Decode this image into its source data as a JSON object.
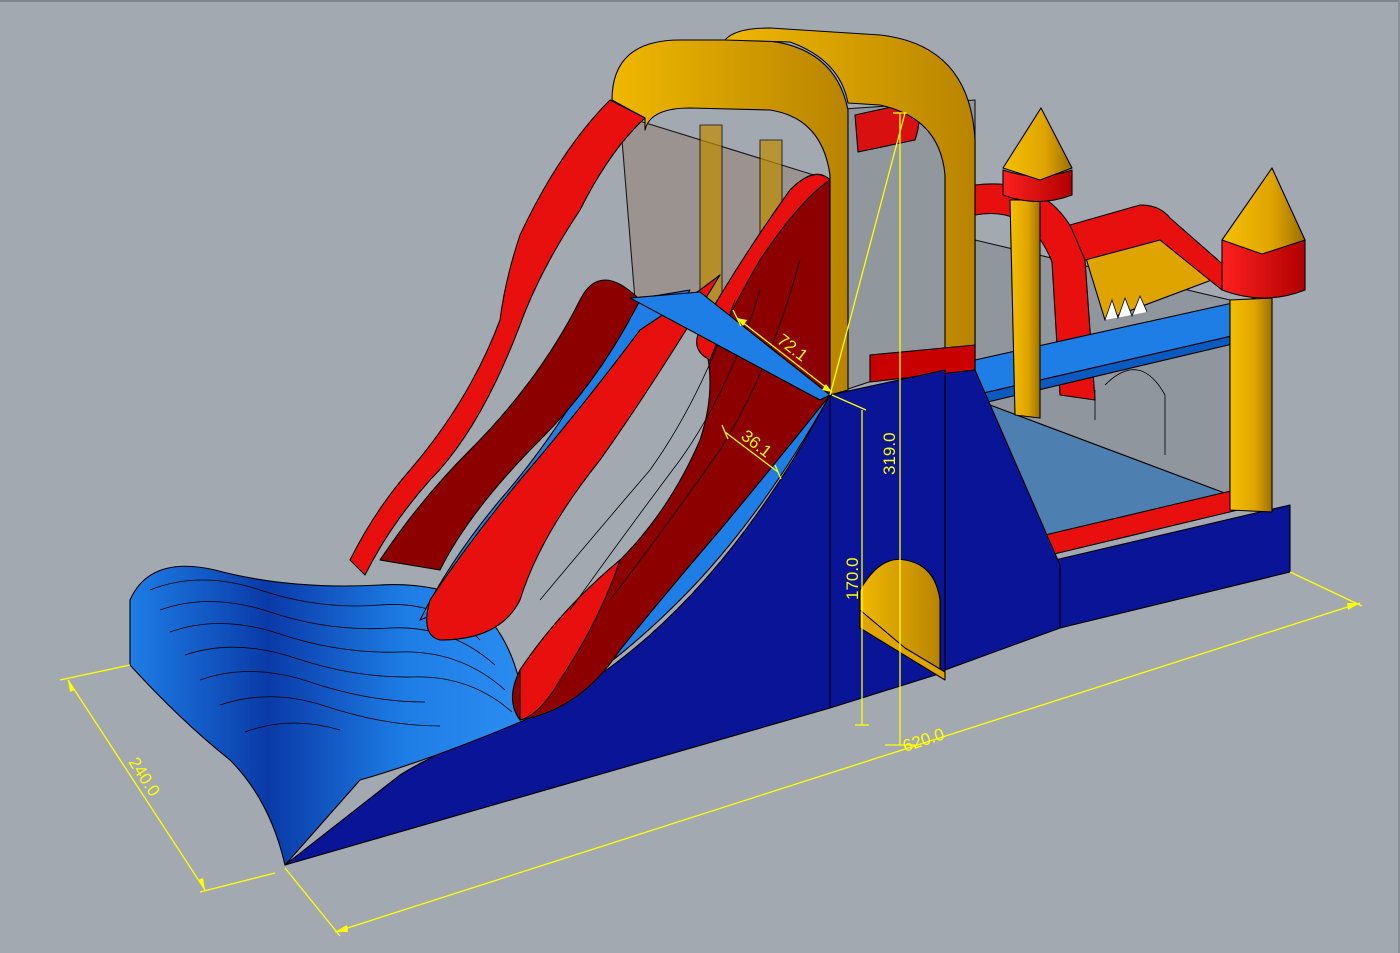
{
  "viewport": {
    "background": "#a3a9b1"
  },
  "colors": {
    "navy": "#0a1496",
    "blue": "#1e7ee6",
    "red": "#e80f0f",
    "dark_red": "#8c0000",
    "yellow": "#e0a400",
    "dim_yellow": "#ffff00"
  },
  "dimensions": {
    "top_width": "72.1",
    "slide_lane_width": "36.1",
    "total_height": "319.0",
    "platform_height": "170.0",
    "total_length": "620.0",
    "total_depth": "240.0"
  }
}
